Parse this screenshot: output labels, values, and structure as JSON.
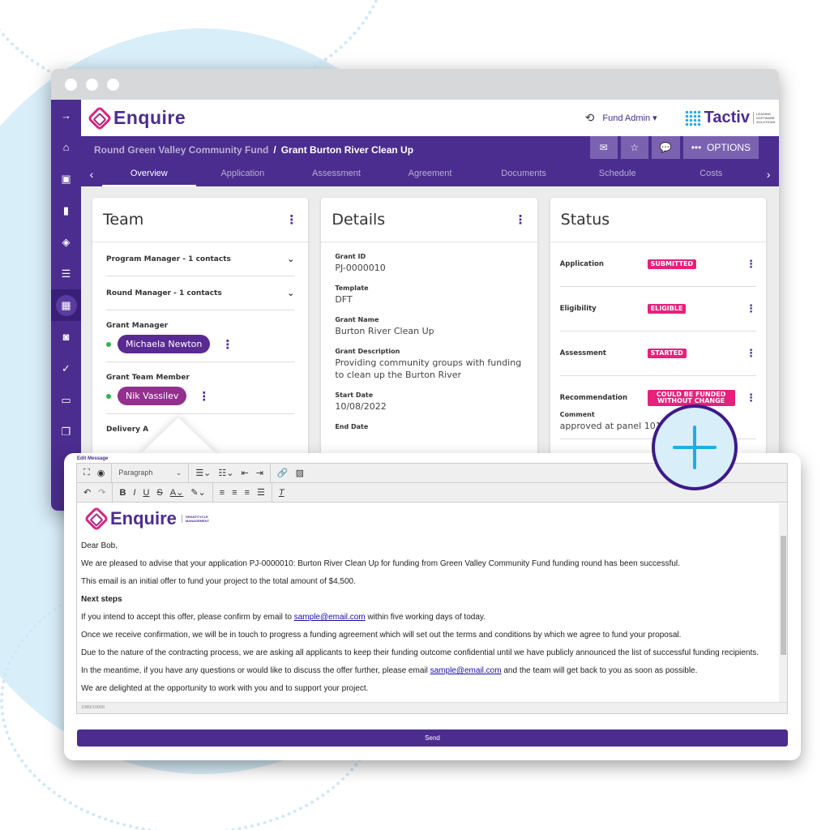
{
  "app": {
    "brand": "Enquire",
    "partner_brand": "Tactiv",
    "partner_tagline": "LEADING SOFTWARE SOLUTIONS",
    "user_menu": "Fund Admin"
  },
  "sidebar": {
    "items": [
      {
        "icon": "arrow-right-icon",
        "glyph": "→"
      },
      {
        "icon": "home-icon",
        "glyph": "⌂"
      },
      {
        "icon": "contact-card-icon",
        "glyph": "▣"
      },
      {
        "icon": "bookmark-icon",
        "glyph": "▮"
      },
      {
        "icon": "layers-icon",
        "glyph": "◈"
      },
      {
        "icon": "list-icon",
        "glyph": "☰"
      },
      {
        "icon": "dashboard-icon",
        "glyph": "▦"
      },
      {
        "icon": "document-search-icon",
        "glyph": "◙"
      },
      {
        "icon": "checks-icon",
        "glyph": "✓"
      },
      {
        "icon": "card-icon",
        "glyph": "▭"
      },
      {
        "icon": "copy-icon",
        "glyph": "❐"
      }
    ]
  },
  "breadcrumb": {
    "parent": "Round Green Valley Community Fund",
    "separator": "/",
    "current": "Grant Burton River Clean Up"
  },
  "actions": {
    "options_label": "OPTIONS"
  },
  "tabs": [
    "Overview",
    "Application",
    "Assessment",
    "Agreement",
    "Documents",
    "Schedule",
    "Costs"
  ],
  "active_tab": "Overview",
  "team": {
    "title": "Team",
    "groups": [
      {
        "label": "Program Manager - 1 contacts"
      },
      {
        "label": "Round Manager - 1 contacts"
      }
    ],
    "grant_manager_label": "Grant Manager",
    "grant_manager": "Michaela Newton",
    "team_member_label": "Grant Team Member",
    "team_member": "Nik Vassilev",
    "delivery_label": "Delivery A"
  },
  "details": {
    "title": "Details",
    "fields": [
      {
        "label": "Grant ID",
        "value": "PJ-0000010"
      },
      {
        "label": "Template",
        "value": "DFT"
      },
      {
        "label": "Grant Name",
        "value": "Burton River Clean Up"
      },
      {
        "label": "Grant Description",
        "value": "Providing community groups with funding to clean up the Burton River"
      },
      {
        "label": "Start Date",
        "value": "10/08/2022"
      },
      {
        "label": "End Date",
        "value": ""
      }
    ]
  },
  "status": {
    "title": "Status",
    "rows": [
      {
        "name": "Application",
        "badge": "SUBMITTED"
      },
      {
        "name": "Eligibility",
        "badge": "ELIGIBLE"
      },
      {
        "name": "Assessment",
        "badge": "STARTED"
      },
      {
        "name": "Recommendation",
        "badge": "COULD BE FUNDED WITHOUT CHANGE"
      }
    ],
    "comment_label": "Comment",
    "comment": "approved at panel 101",
    "badge_color": "#e7207b"
  },
  "editor": {
    "label": "Edit Message",
    "format_select": "Paragraph",
    "mail_logo": "Enquire",
    "mail_logo_sub": "GRANTCYCLE MANAGEMENT",
    "greeting": "Dear Bob,",
    "p1": "We are pleased to advise that your application PJ-0000010: Burton River Clean Up for funding from Green Valley Community Fund funding round has been successful.",
    "p2": "This email is an initial offer to fund your project to the total amount of $4,500.",
    "heading": "Next steps",
    "p3_before": "If you intend to accept this offer, please confirm by email to ",
    "p3_link": "sample@email.com",
    "p3_after": " within five working days of today.",
    "p4": "Once we receive confirmation, we will be in touch to progress a funding agreement which will set out the terms and conditions by which we agree to fund your proposal.",
    "p5": "Due to the nature of the contracting process, we are asking all applicants to keep their funding outcome confidential until we have publicly announced the list of successful funding recipients.",
    "p6_before": "In the meantime, if you have any questions or would like to discuss the offer further, please email ",
    "p6_link": "sample@email.com",
    "p6_after": " and the team will get back to you as soon as possible.",
    "p7": "We are delighted at the opportunity to work with you and to support your project.",
    "char_count": "1089/10000",
    "send_label": "Send"
  },
  "colors": {
    "brand_purple": "#4b2d8f",
    "accent_magenta": "#e7207b",
    "accent_cyan": "#1ab0e3"
  }
}
